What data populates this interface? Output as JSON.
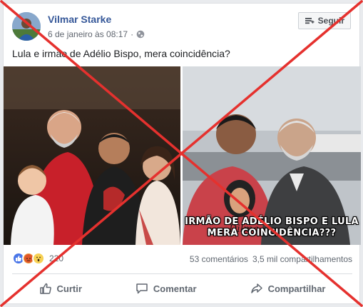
{
  "post": {
    "author": "Vilmar Starke",
    "timestamp": "6 de janeiro às 08:17",
    "follow_label": "Seguir",
    "text": "Lula e irmão de Adélio Bispo, mera coincidência?",
    "image_caption_line1": "IRMÃO DE ADÉLIO BISPO E LULA",
    "image_caption_line2": "MERA COINCIDÊNCIA???"
  },
  "stats": {
    "reactions": [
      "like-icon",
      "angry-icon",
      "wow-icon"
    ],
    "reaction_count": "220",
    "comments": "53 comentários",
    "shares": "3,5 mil compartilhamentos"
  },
  "actions": {
    "like": "Curtir",
    "comment": "Comentar",
    "share": "Compartilhar"
  },
  "colors": {
    "author_link": "#365899",
    "cross": "#e5312e",
    "like_blue": "#4a76e8"
  }
}
